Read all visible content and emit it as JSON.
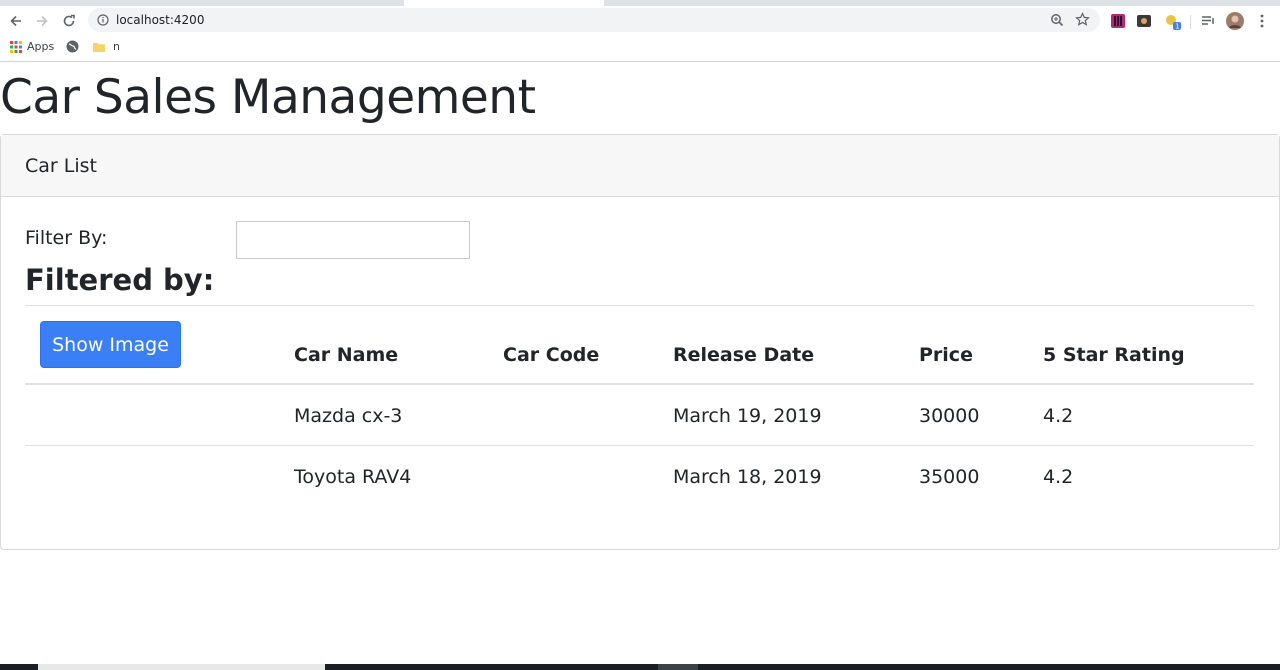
{
  "browser": {
    "url": "localhost:4200",
    "bookmarks": [
      {
        "label": "Apps",
        "icon": "apps-grid-icon"
      },
      {
        "label": "",
        "icon": "globe-icon"
      },
      {
        "label": "n",
        "icon": "folder-icon"
      }
    ],
    "extension_badge": "1"
  },
  "page": {
    "title": "Car Sales Management",
    "card_header": "Car List",
    "filter_label": "Filter By:",
    "filter_value": "",
    "filtered_heading": "Filtered by:",
    "show_image_button": "Show Image",
    "columns": {
      "name": "Car Name",
      "code": "Car Code",
      "date": "Release Date",
      "price": "Price",
      "rating": "5 Star Rating"
    },
    "rows": [
      {
        "name": "Mazda cx-3",
        "code": "",
        "date": "March 19, 2019",
        "price": "30000",
        "rating": "4.2"
      },
      {
        "name": "Toyota RAV4",
        "code": "",
        "date": "March 18, 2019",
        "price": "35000",
        "rating": "4.2"
      }
    ]
  },
  "colors": {
    "primary_button": "#3a7ff6",
    "card_header_bg": "#f7f7f7"
  }
}
